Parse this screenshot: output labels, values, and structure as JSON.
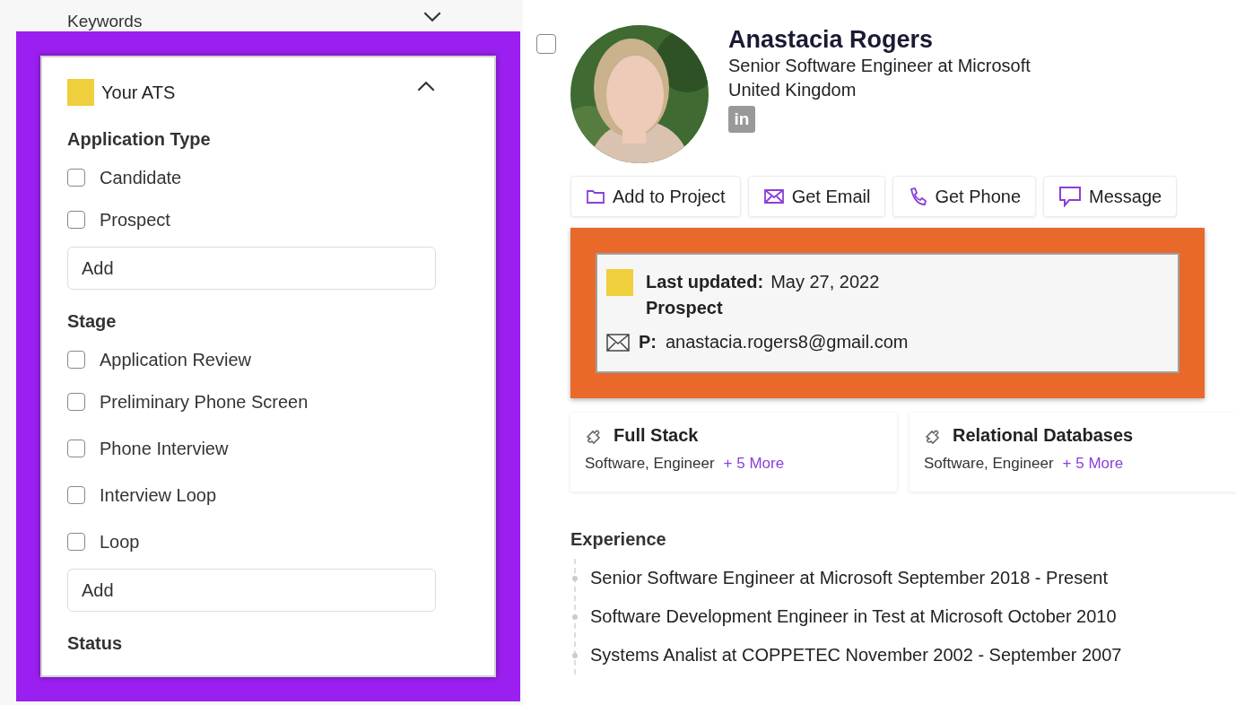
{
  "filters": {
    "collapsed_header": {
      "label": "Keywords",
      "expanded": false
    },
    "ats": {
      "label": "Your ATS",
      "color": "#f0cf3c",
      "expanded": true,
      "sections": [
        {
          "title": "Application Type",
          "options": [
            {
              "label": "Candidate",
              "checked": false
            },
            {
              "label": "Prospect",
              "checked": false
            }
          ],
          "add": {
            "placeholder": "Add"
          }
        },
        {
          "title": "Stage",
          "options": [
            {
              "label": "Application Review",
              "checked": false
            },
            {
              "label": "Preliminary Phone Screen",
              "checked": false
            },
            {
              "label": "Phone Interview",
              "checked": false
            },
            {
              "label": "Interview Loop",
              "checked": false
            },
            {
              "label": "Loop",
              "checked": false
            }
          ],
          "add": {
            "placeholder": "Add"
          }
        },
        {
          "title": "Status"
        }
      ]
    }
  },
  "profile": {
    "selected": false,
    "avatar": {
      "kind": "picture"
    },
    "name": "Anastacia Rogers",
    "headline": "Senior Software Engineer at Microsoft",
    "location": "United Kingdom",
    "social": [
      "in"
    ],
    "actions": [
      {
        "label": "Add to Project",
        "kind": "folder"
      },
      {
        "label": "Get Email",
        "kind": "email"
      },
      {
        "label": "Get Phone",
        "kind": "phone"
      },
      {
        "label": "Message",
        "kind": "message"
      }
    ],
    "ats_card": {
      "color": "#f0cf3c",
      "updated_label": "Last updated:",
      "updated_date": "May 27, 2022",
      "type": "Prospect",
      "email_label": "P:",
      "email": "anastacia.rogers8@gmail.com"
    },
    "skills": [
      {
        "title": "Full Stack",
        "tags": "Software, Engineer",
        "more": "+ 5 More"
      },
      {
        "title": "Relational Databases",
        "tags": "Software, Engineer",
        "more": "+ 5 More"
      }
    ],
    "experience": {
      "title": "Experience",
      "items": [
        "Senior Software Engineer at Microsoft September 2018 - Present",
        "Software Development Engineer in Test at Microsoft October 2010",
        "Systems Analist at COPPETEC November 2002 - September 2007"
      ]
    }
  }
}
